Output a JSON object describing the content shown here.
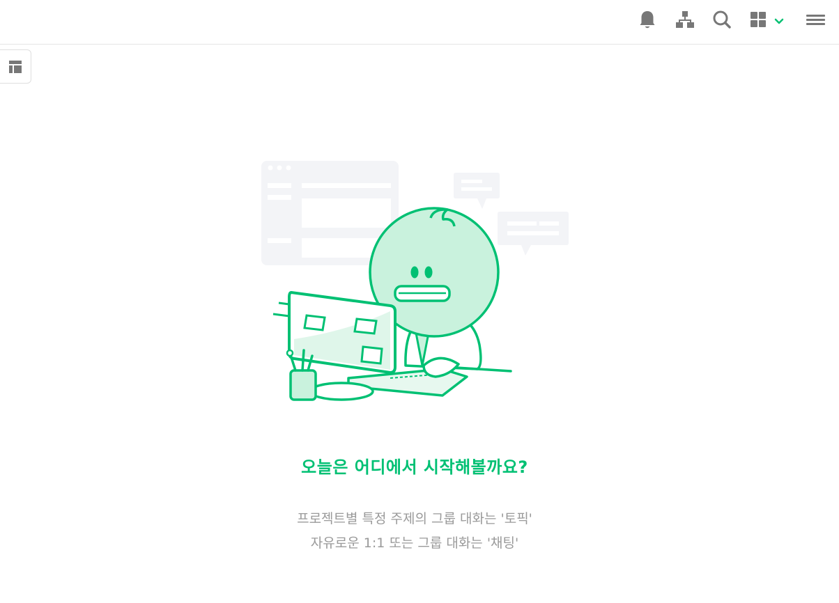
{
  "header": {
    "icons": [
      "bell-icon",
      "org-chart-icon",
      "search-icon",
      "apps-grid-icon",
      "chevron-down-icon",
      "hamburger-menu-icon"
    ]
  },
  "sidebar_toggle": {
    "icon": "layout-panel-icon"
  },
  "empty_state": {
    "title": "오늘은 어디에서 시작해볼까요?",
    "line1": "프로젝트별 특정 주제의 그룹 대화는 '토픽'",
    "line2": "자유로운 1:1 또는 그룹 대화는 '채팅'"
  },
  "colors": {
    "accent": "#00c073",
    "icon_gray": "#777777",
    "text_gray": "#9a9a9a",
    "mint_fill": "#c9f2dd",
    "bg_panel": "#f3f4f7"
  }
}
